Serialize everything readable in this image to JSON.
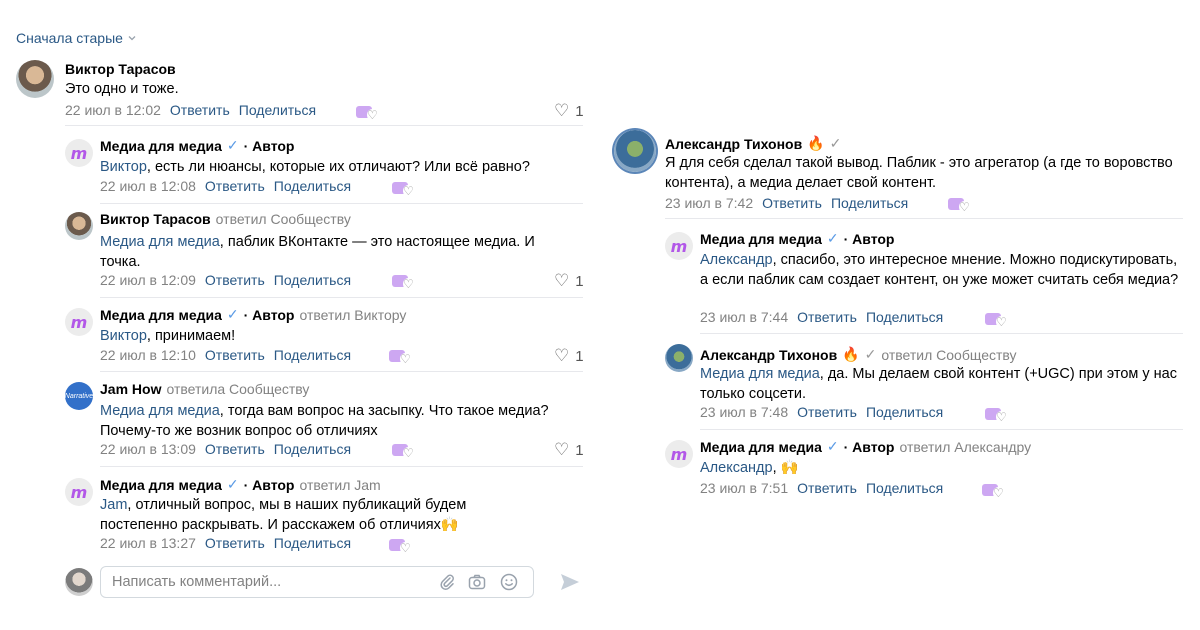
{
  "sort": {
    "label": "Сначала старые"
  },
  "left": {
    "main": {
      "author": "Виктор Тарасов",
      "text": "Это одно и тоже.",
      "date": "22 июл в 12:02",
      "reply": "Ответить",
      "share": "Поделиться",
      "likes": "1"
    },
    "replies": [
      {
        "author": "Медиа для медиа",
        "role": "· Автор",
        "replied_to": "",
        "mention": "Виктор",
        "text": ", есть ли нюансы, которые их отличают? Или всё равно?",
        "date": "22 июл в 12:08",
        "reply": "Ответить",
        "share": "Поделиться",
        "likes": ""
      },
      {
        "author": "Виктор Тарасов",
        "role": "",
        "replied_to": "ответил Сообществу",
        "mention": "Медиа для медиа",
        "text": ", паблик ВКонтакте — это настоящее медиа. И точка.",
        "date": "22 июл в 12:09",
        "reply": "Ответить",
        "share": "Поделиться",
        "likes": "1"
      },
      {
        "author": "Медиа для медиа",
        "role": "· Автор",
        "replied_to": "ответил Виктору",
        "mention": "Виктор",
        "text": ", принимаем!",
        "date": "22 июл в 12:10",
        "reply": "Ответить",
        "share": "Поделиться",
        "likes": "1"
      },
      {
        "author": "Jam How",
        "role": "",
        "replied_to": "ответила Сообществу",
        "mention": "Медиа для медиа",
        "text": ", тогда вам вопрос на засыпку. Что такое медиа? Почему-то же возник вопрос об отличиях",
        "date": "22 июл в 13:09",
        "reply": "Ответить",
        "share": "Поделиться",
        "likes": "1"
      },
      {
        "author": "Медиа для медиа",
        "role": "· Автор",
        "replied_to": "ответил Jam",
        "mention": "Jam",
        "text": ", отличный вопрос, мы в наших публикаций будем постепенно раскрывать. И расскажем об отличиях🙌",
        "date": "22 июл в 13:27",
        "reply": "Ответить",
        "share": "Поделиться",
        "likes": ""
      }
    ]
  },
  "right": {
    "main": {
      "author": "Александр Тихонов",
      "text": "Я для себя сделал такой вывод. Паблик - это агрегатор (а где то воровство контента), а медиа делает свой контент.",
      "date": "23 июл в 7:42",
      "reply": "Ответить",
      "share": "Поделиться"
    },
    "replies": [
      {
        "author": "Медиа для медиа",
        "role": "· Автор",
        "replied_to": "",
        "mention": "Александр",
        "text": ", спасибо, это интересное мнение. Можно подискутировать, а если паблик сам создает контент, он уже может считать себя медиа?",
        "date": "23 июл в 7:44",
        "reply": "Ответить",
        "share": "Поделиться"
      },
      {
        "author": "Александр Тихонов",
        "role": "",
        "replied_to": "ответил Сообществу",
        "mention": "Медиа для медиа",
        "text": ", да. Мы делаем свой контент (+UGC) при этом у нас только соцсети.",
        "date": "23 июл в 7:48",
        "reply": "Ответить",
        "share": "Поделиться"
      },
      {
        "author": "Медиа для медиа",
        "role": "· Автор",
        "replied_to": "ответил Александру",
        "mention": "Александр",
        "text": ", 🙌",
        "date": "23 июл в 7:51",
        "reply": "Ответить",
        "share": "Поделиться"
      }
    ]
  },
  "composer": {
    "placeholder": "Написать комментарий..."
  },
  "icons": {
    "attach": "paperclip-icon",
    "camera": "camera-icon",
    "emoji": "smile-icon",
    "send": "send-icon"
  }
}
